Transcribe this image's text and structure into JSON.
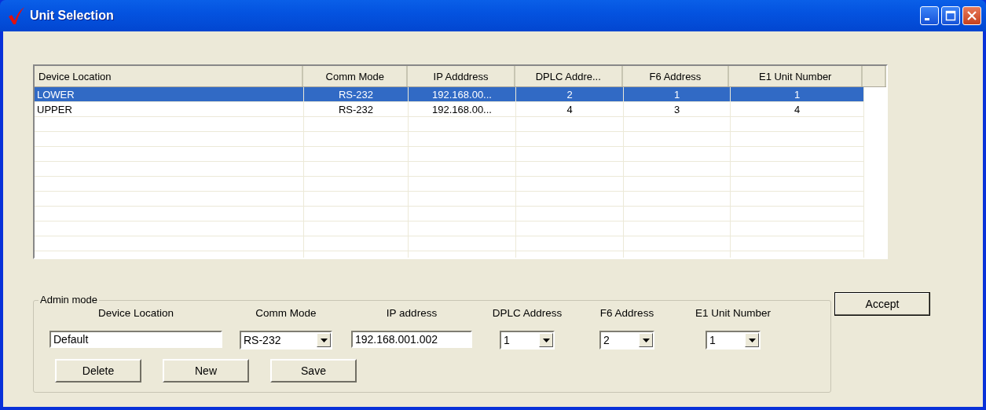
{
  "window": {
    "title": "Unit Selection"
  },
  "table": {
    "columns": [
      "Device Location",
      "Comm Mode",
      "IP Adddress",
      "DPLC Addre...",
      "F6 Address",
      "E1 Unit Number"
    ],
    "rows": [
      {
        "cells": [
          "LOWER",
          "RS-232",
          "192.168.00...",
          "2",
          "1",
          "1"
        ],
        "selected": true
      },
      {
        "cells": [
          "UPPER",
          "RS-232",
          "192.168.00...",
          "4",
          "3",
          "4"
        ],
        "selected": false
      }
    ]
  },
  "admin": {
    "title": "Admin mode",
    "fields": [
      {
        "label": "Device Location",
        "kind": "text",
        "value": "Default"
      },
      {
        "label": "Comm Mode",
        "kind": "combo",
        "value": "RS-232"
      },
      {
        "label": "IP address",
        "kind": "text",
        "value": "192.168.001.002"
      },
      {
        "label": "DPLC Address",
        "kind": "combo",
        "value": "1"
      },
      {
        "label": "F6 Address",
        "kind": "combo",
        "value": "2"
      },
      {
        "label": "E1 Unit Number",
        "kind": "combo",
        "value": "1"
      }
    ],
    "buttons": [
      "Delete",
      "New",
      "Save"
    ]
  },
  "accept_button": "Accept"
}
